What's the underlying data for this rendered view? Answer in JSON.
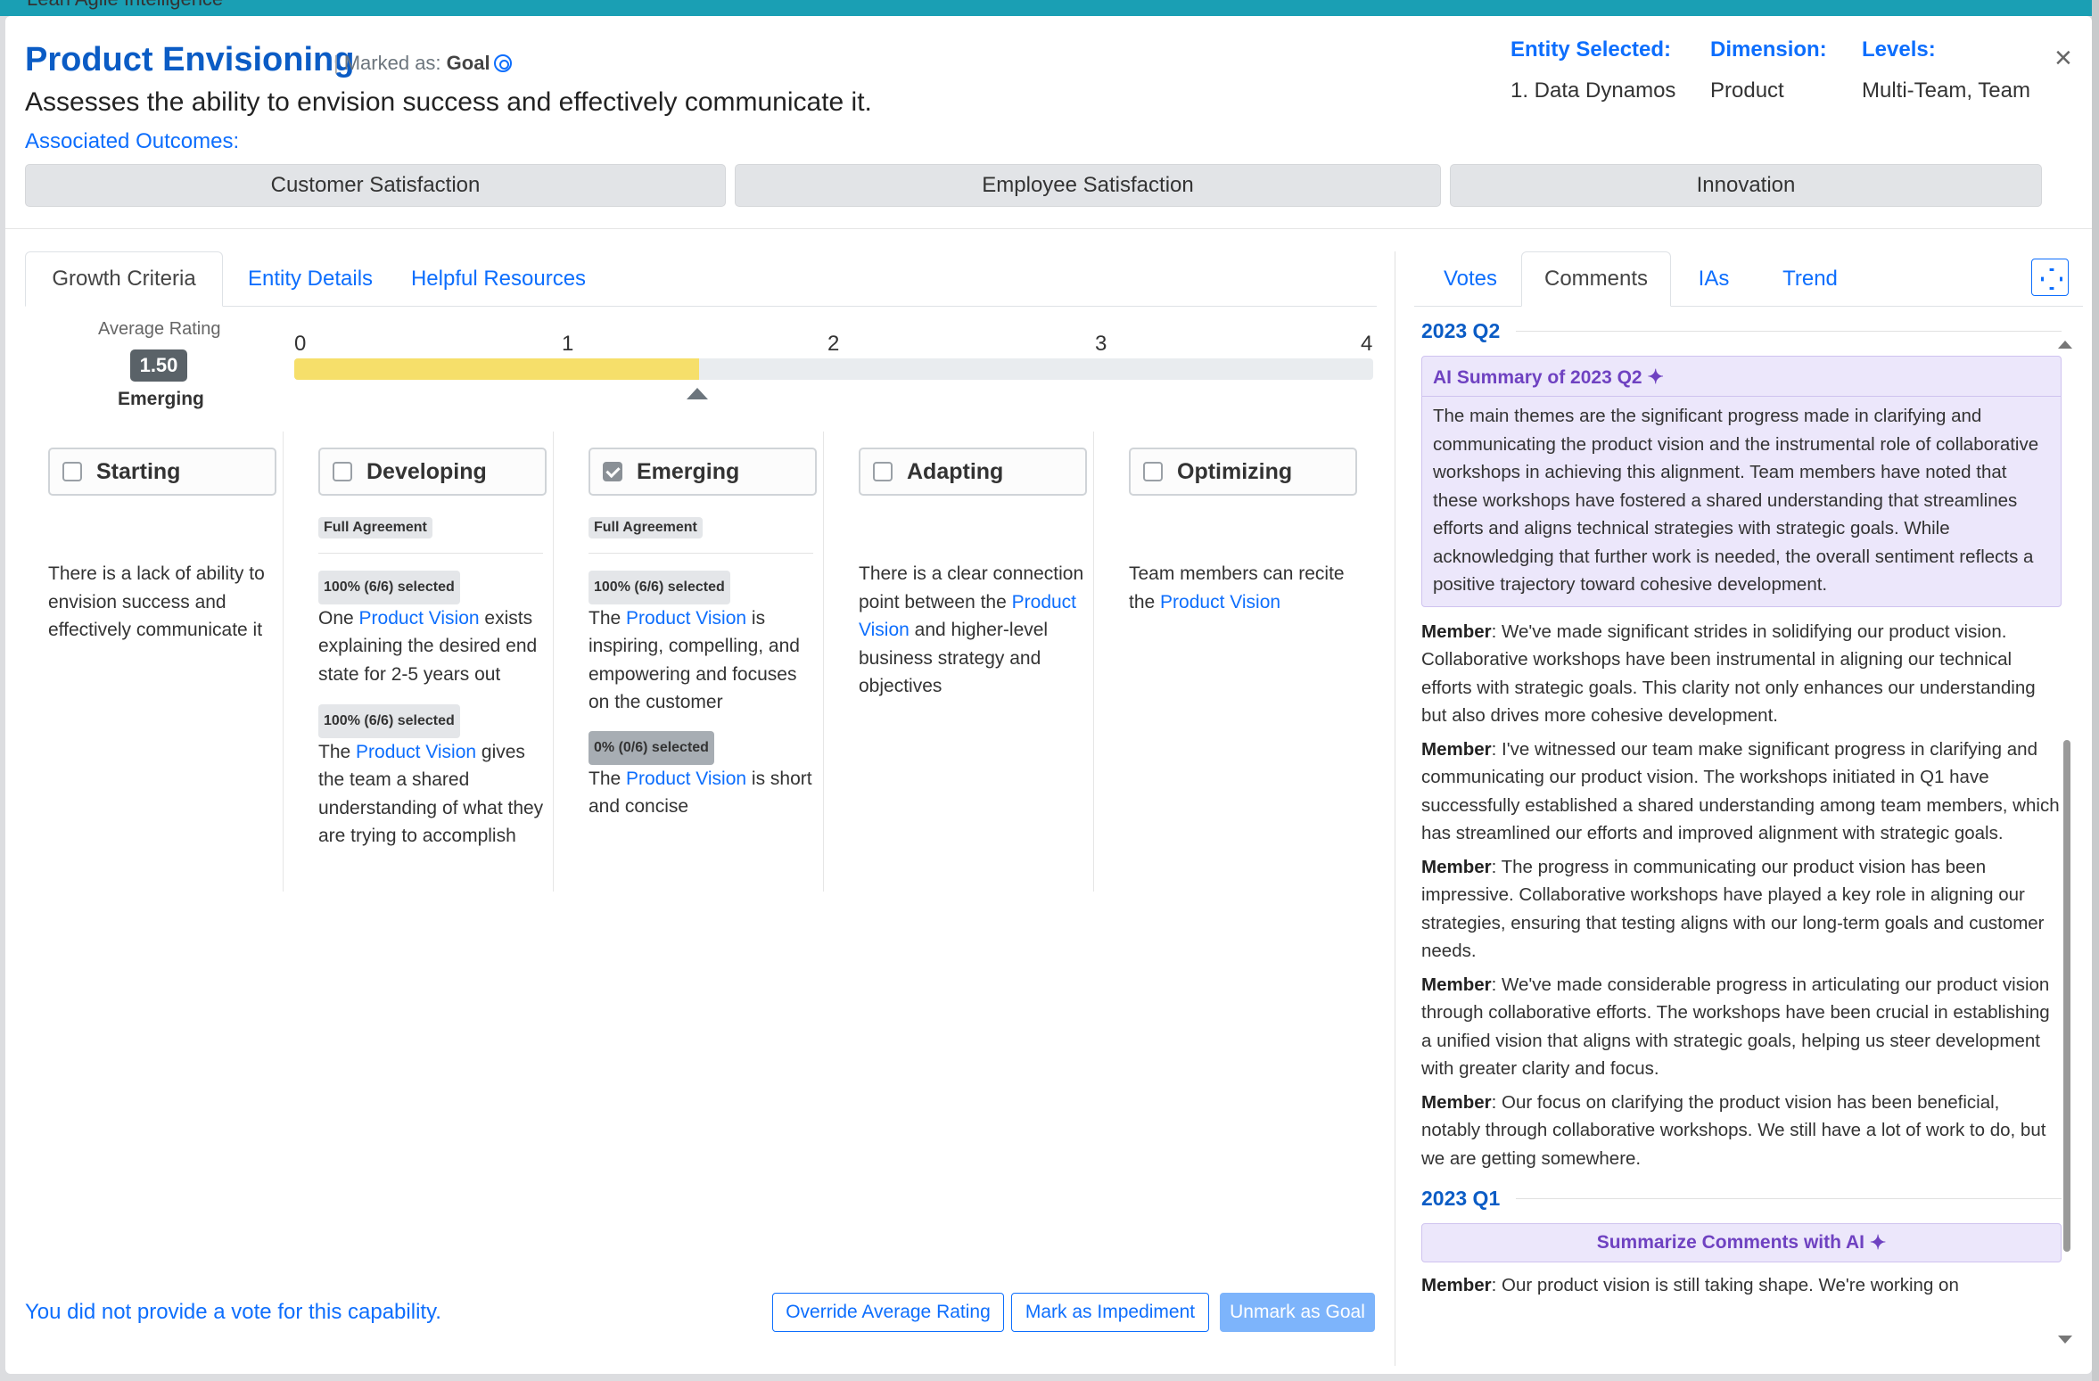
{
  "background": {
    "app_title": "Lean Agile Intelligence"
  },
  "header": {
    "title": "Product Envisioning",
    "marked_as_label": "Marked as:",
    "marked_as_value": "Goal",
    "subtitle": "Assesses the ability to envision success and effectively communicate it.",
    "associated_outcomes_label": "Associated Outcomes:",
    "outcomes": [
      "Customer Satisfaction",
      "Employee Satisfaction",
      "Innovation"
    ],
    "entity_label": "Entity Selected:",
    "entity_value": "1. Data Dynamos",
    "dimension_label": "Dimension:",
    "dimension_value": "Product",
    "levels_label": "Levels:",
    "levels_value": "Multi-Team, Team",
    "close_label": "×"
  },
  "left_tabs": [
    "Growth Criteria",
    "Entity Details",
    "Helpful Resources"
  ],
  "rating": {
    "label": "Average Rating",
    "value": "1.50",
    "level": "Emerging",
    "scale": [
      "0",
      "1",
      "2",
      "3",
      "4"
    ],
    "fill_fraction": 0.375
  },
  "levels": [
    {
      "name": "Starting",
      "checked": false,
      "agreement": "",
      "criteria": [
        {
          "badge": "",
          "pre": "There is a lack of ability to envision success and effectively communicate it",
          "link": "",
          "post": ""
        }
      ]
    },
    {
      "name": "Developing",
      "checked": false,
      "agreement": "Full Agreement",
      "criteria": [
        {
          "badge": "100% (6/6) selected",
          "pre": "One ",
          "link": "Product Vision",
          "post": " exists explaining the desired end state for 2-5 years out"
        },
        {
          "badge": "100% (6/6) selected",
          "pre": "The ",
          "link": "Product Vision",
          "post": " gives the team a shared understanding of what they are trying to accomplish"
        }
      ]
    },
    {
      "name": "Emerging",
      "checked": true,
      "agreement": "Full Agreement",
      "criteria": [
        {
          "badge": "100% (6/6) selected",
          "pre": "The ",
          "link": "Product Vision",
          "post": " is inspiring, compelling, and empowering and focuses on the customer"
        },
        {
          "badge": "0% (0/6) selected",
          "pre": "The ",
          "link": "Product Vision",
          "post": " is short and concise"
        }
      ]
    },
    {
      "name": "Adapting",
      "checked": false,
      "agreement": "",
      "criteria": [
        {
          "badge": "",
          "pre": "There is a clear connection point between the ",
          "link": "Product Vision",
          "post": " and higher-level business strategy and objectives"
        }
      ]
    },
    {
      "name": "Optimizing",
      "checked": false,
      "agreement": "",
      "criteria": [
        {
          "badge": "",
          "pre": "Team members can recite the ",
          "link": "Product Vision",
          "post": ""
        }
      ]
    }
  ],
  "footer": {
    "vote_message": "You did not provide a vote for this capability.",
    "override_label": "Override Average Rating",
    "impediment_label": "Mark as Impediment",
    "unmark_label": "Unmark as Goal"
  },
  "right_tabs": [
    "Votes",
    "Comments",
    "IAs",
    "Trend"
  ],
  "comments": {
    "q2_label": "2023 Q2",
    "ai_summary_title": "AI Summary of 2023 Q2",
    "ai_summary_body": "The main themes are the significant progress made in clarifying and communicating the product vision and the instrumental role of collaborative workshops in achieving this alignment. Team members have noted that these workshops have fostered a shared understanding that streamlines efforts and aligns technical strategies with strategic goals. While acknowledging that further work is needed, the overall sentiment reflects a positive trajectory toward cohesive development.",
    "q2_comments": [
      {
        "author": "Member",
        "text": ": We've made significant strides in solidifying our product vision. Collaborative workshops have been instrumental in aligning our technical efforts with strategic goals. This clarity not only enhances our understanding but also drives more cohesive development."
      },
      {
        "author": "Member",
        "text": ": I've witnessed our team make significant progress in clarifying and communicating our product vision. The workshops initiated in Q1 have successfully established a shared understanding among team members, which has streamlined our efforts and improved alignment with strategic goals."
      },
      {
        "author": "Member",
        "text": ": The progress in communicating our product vision has been impressive. Collaborative workshops have played a key role in aligning our strategies, ensuring that testing aligns with our long-term goals and customer needs."
      },
      {
        "author": "Member",
        "text": ": We've made considerable progress in articulating our product vision through collaborative efforts. The workshops have been crucial in establishing a unified vision that aligns with strategic goals, helping us steer development with greater clarity and focus."
      },
      {
        "author": "Member",
        "text": ": Our focus on clarifying the product vision has been beneficial, notably through collaborative workshops. We still have a lot of work to do, but we are getting somewhere."
      }
    ],
    "q1_label": "2023 Q1",
    "summarize_button": "Summarize Comments with AI",
    "q1_comments": [
      {
        "author": "Member",
        "text": ": Our product vision is still taking shape. We're working on"
      }
    ]
  },
  "colors": {
    "primary": "#0d6efd",
    "ai_purple": "#6f42c1",
    "rating_fill": "#f6df6a"
  },
  "icons": {
    "goal": "target-icon",
    "sparkle": "sparkle-icon",
    "expand": "expand-icon",
    "close": "close-icon"
  }
}
